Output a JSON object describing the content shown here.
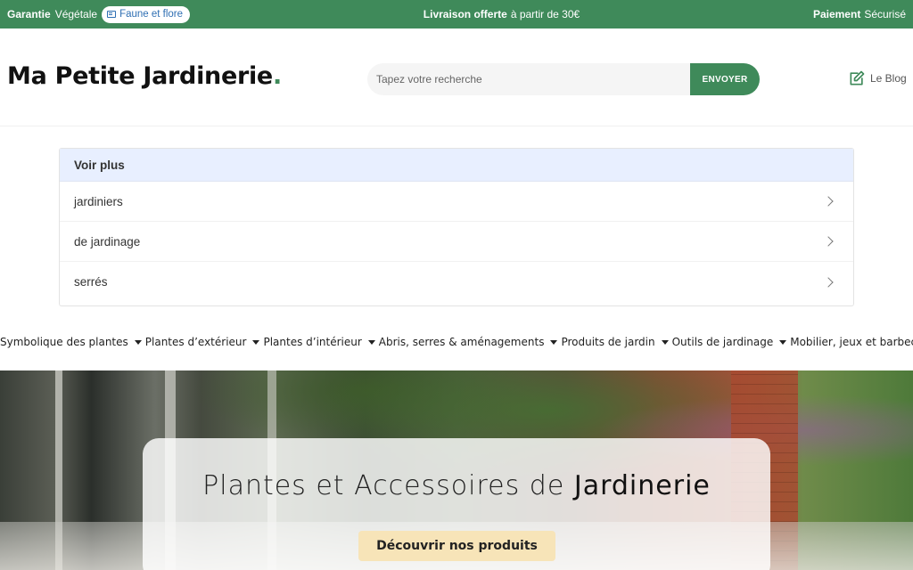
{
  "topbar": {
    "left_bold": "Garantie",
    "left_text": "Végétale",
    "pill_label": "Faune et flore",
    "center_bold": "Livraison offerte",
    "center_text": "à partir de 30€",
    "right_bold": "Paiement",
    "right_text": "Sécurisé"
  },
  "header": {
    "logo_text": "Ma Petite Jardinerie",
    "logo_dot": ".",
    "search_placeholder": "Tapez votre recherche",
    "search_button": "ENVOYER",
    "blog_label": "Le Blog"
  },
  "suggestions": {
    "header": "Voir plus",
    "items": [
      {
        "label": "jardiniers"
      },
      {
        "label": "de jardinage"
      },
      {
        "label": "serrés"
      }
    ]
  },
  "categories": [
    {
      "label": "Symbolique des plantes"
    },
    {
      "label": "Plantes d’extérieur"
    },
    {
      "label": "Plantes d’intérieur"
    },
    {
      "label": "Abris, serres & aménagements"
    },
    {
      "label": "Produits de jardin"
    },
    {
      "label": "Outils de jardinage"
    },
    {
      "label": "Mobilier, jeux et barbecues"
    }
  ],
  "hero": {
    "title_light": "Plantes et Accessoires de",
    "title_bold": "Jardinerie",
    "cta": "Découvrir nos produits"
  },
  "colors": {
    "brand_green": "#3f8a5a",
    "cta_bg": "#f7e4b8",
    "suggest_head_bg": "#e8efff"
  }
}
